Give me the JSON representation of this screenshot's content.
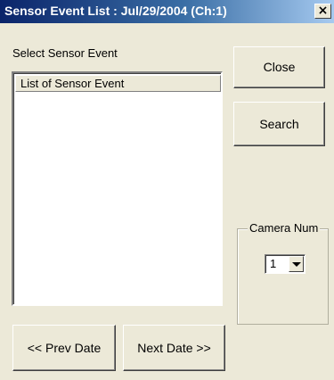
{
  "window": {
    "title": "Sensor Event List : Jul/29/2004 (Ch:1)",
    "close_glyph": "×"
  },
  "select_label": "Select Sensor Event",
  "list": {
    "header": "List of Sensor Event",
    "items": []
  },
  "buttons": {
    "close": "Close",
    "search": "Search",
    "prev_date": "<< Prev Date",
    "next_date": "Next Date >>"
  },
  "camera": {
    "group_label": "Camera Num",
    "selected": "1"
  }
}
